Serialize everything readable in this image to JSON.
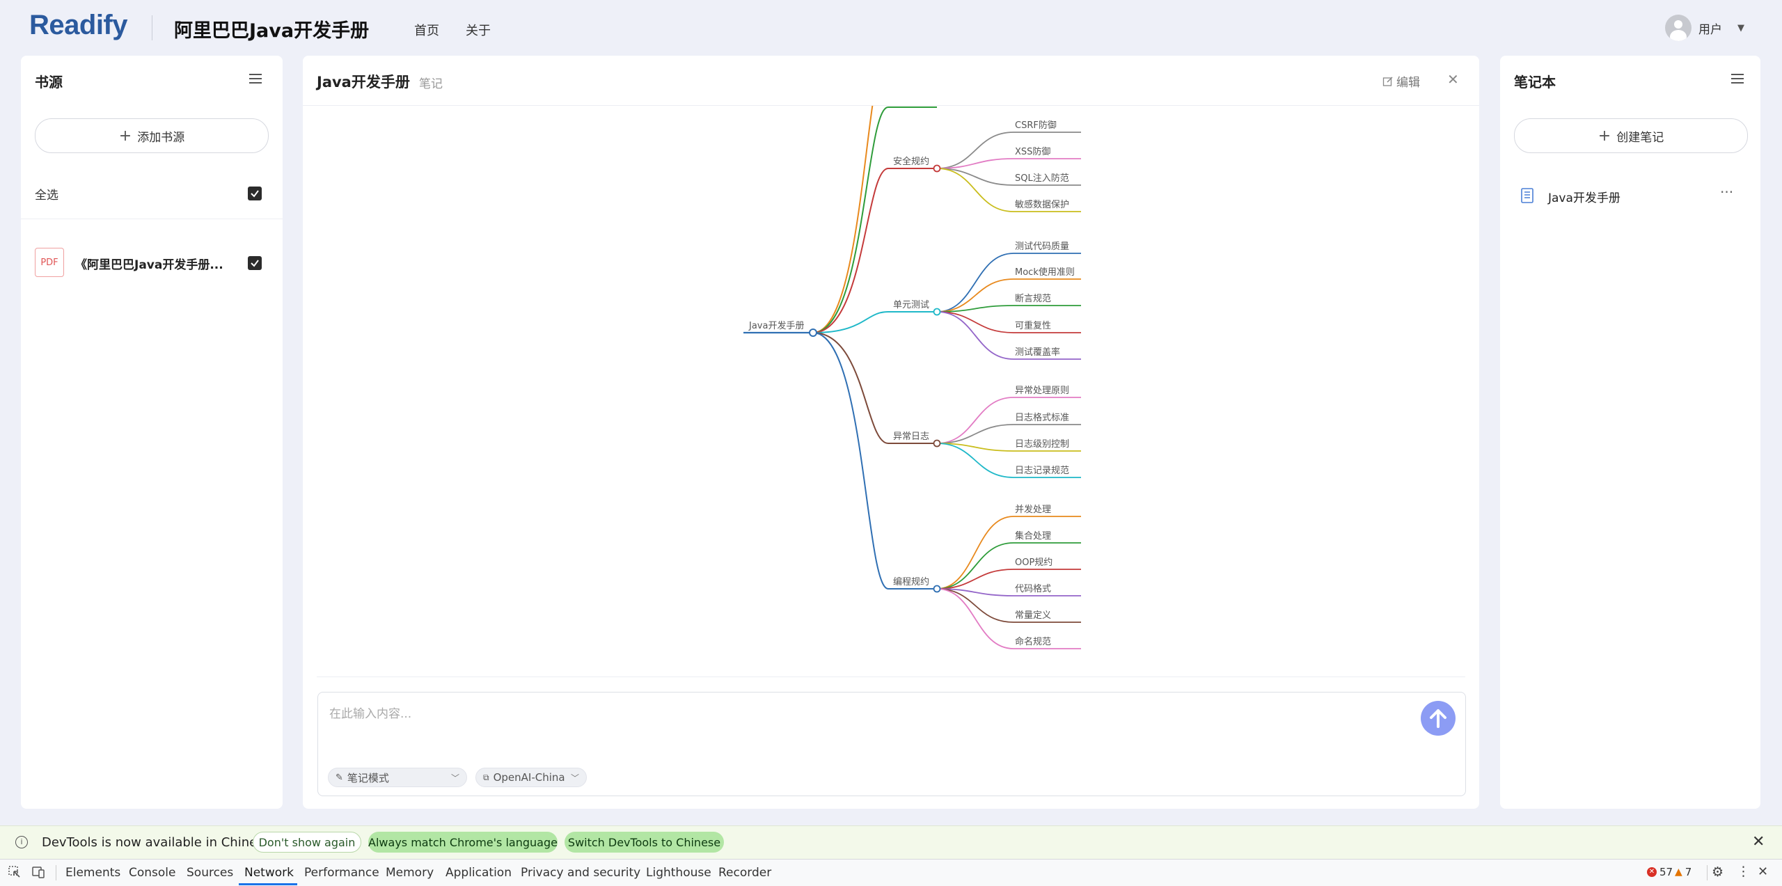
{
  "header": {
    "logo": "Readify",
    "app_title": "阿里巴巴Java开发手册",
    "nav": [
      "首页",
      "关于"
    ],
    "user_label": "用户"
  },
  "left_panel": {
    "title": "书源",
    "add_button": "添加书源",
    "select_all": "全选",
    "select_all_checked": true,
    "items": [
      {
        "type": "PDF",
        "title": "《阿里巴巴Java开发手册...",
        "checked": true
      }
    ]
  },
  "center_panel": {
    "title": "Java开发手册",
    "subtitle": "笔记",
    "edit_label": "编辑",
    "composer": {
      "placeholder": "在此输入内容...",
      "mode_chip": "笔记模式",
      "model_chip": "OpenAI-China"
    }
  },
  "mindmap": {
    "root": "Java开发手册",
    "branches": [
      {
        "label": "",
        "color": "#e8891d",
        "children": []
      },
      {
        "label": "",
        "color": "#2e9c3a",
        "children": []
      },
      {
        "label": "安全规约",
        "color": "#c43a3a",
        "children": [
          {
            "label": "CSRF防御",
            "color": "#8a8a8a"
          },
          {
            "label": "XSS防御",
            "color": "#e27cc4"
          },
          {
            "label": "SQL注入防范",
            "color": "#8a8a8a"
          },
          {
            "label": "敏感数据保护",
            "color": "#c9bd1c"
          }
        ]
      },
      {
        "label": "单元测试",
        "color": "#1fb8c8",
        "children": [
          {
            "label": "测试代码质量",
            "color": "#2f6fb3"
          },
          {
            "label": "Mock使用准则",
            "color": "#e8891d"
          },
          {
            "label": "断言规范",
            "color": "#2e9c3a"
          },
          {
            "label": "可重复性",
            "color": "#c43a3a"
          },
          {
            "label": "测试覆盖率",
            "color": "#9466c9"
          }
        ]
      },
      {
        "label": "异常日志",
        "color": "#7d4a3a",
        "children": [
          {
            "label": "异常处理原则",
            "color": "#e27cc4"
          },
          {
            "label": "日志格式标准",
            "color": "#8a8a8a"
          },
          {
            "label": "日志级别控制",
            "color": "#c9bd1c"
          },
          {
            "label": "日志记录规范",
            "color": "#1fb8c8"
          }
        ]
      },
      {
        "label": "编程规约",
        "color": "#2f6fb3",
        "children": [
          {
            "label": "并发处理",
            "color": "#e8891d"
          },
          {
            "label": "集合处理",
            "color": "#2e9c3a"
          },
          {
            "label": "OOP规约",
            "color": "#c43a3a"
          },
          {
            "label": "代码格式",
            "color": "#9466c9"
          },
          {
            "label": "常量定义",
            "color": "#7d4a3a"
          },
          {
            "label": "命名规范",
            "color": "#e27cc4"
          }
        ]
      }
    ]
  },
  "right_panel": {
    "title": "笔记本",
    "create_button": "创建笔记",
    "notes": [
      {
        "title": "Java开发手册"
      }
    ]
  },
  "devtools_notice": {
    "text": "DevTools is now available in Chinese",
    "buttons": [
      "Don't show again",
      "Always match Chrome's language",
      "Switch DevTools to Chinese"
    ]
  },
  "devtools": {
    "tabs": [
      "Elements",
      "Console",
      "Sources",
      "Network",
      "Performance",
      "Memory",
      "Application",
      "Privacy and security",
      "Lighthouse",
      "Recorder"
    ],
    "active_tab": "Network",
    "errors": "57",
    "warnings": "7"
  }
}
